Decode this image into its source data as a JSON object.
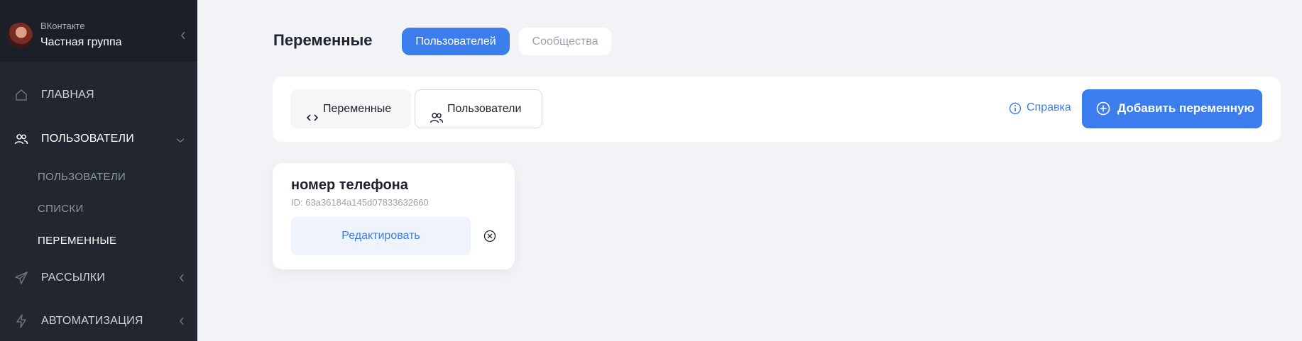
{
  "sidebar": {
    "profile": {
      "network": "ВКонтакте",
      "group_name": "Частная группа"
    },
    "items": [
      {
        "label": "ГЛАВНАЯ",
        "icon": "home-icon"
      },
      {
        "label": "ПОЛЬЗОВАТЕЛИ",
        "icon": "users-icon",
        "expanded": true
      },
      {
        "label": "РАССЫЛКИ",
        "icon": "send-icon"
      },
      {
        "label": "АВТОМАТИЗАЦИЯ",
        "icon": "bolt-icon"
      }
    ],
    "subitems": [
      {
        "label": "ПОЛЬЗОВАТЕЛИ"
      },
      {
        "label": "СПИСКИ"
      },
      {
        "label": "ПЕРЕМЕННЫЕ",
        "active": true
      }
    ]
  },
  "header": {
    "title": "Переменные",
    "tabs": [
      {
        "label": "Пользователей",
        "active": true
      },
      {
        "label": "Сообщества",
        "active": false
      }
    ]
  },
  "toolbar": {
    "tabs": [
      {
        "label": "Переменные",
        "icon": "code-icon"
      },
      {
        "label": "Пользователи",
        "icon": "users-icon"
      }
    ],
    "help_label": "Справка",
    "add_label": "Добавить переменную"
  },
  "variables": [
    {
      "name": "номер телефона",
      "id": "ID: 63a36184a145d07833632660",
      "edit_label": "Редактировать"
    }
  ],
  "colors": {
    "accent": "#3b7ded",
    "sidebar_bg": "#212630",
    "page_bg": "#f2f3f7"
  }
}
